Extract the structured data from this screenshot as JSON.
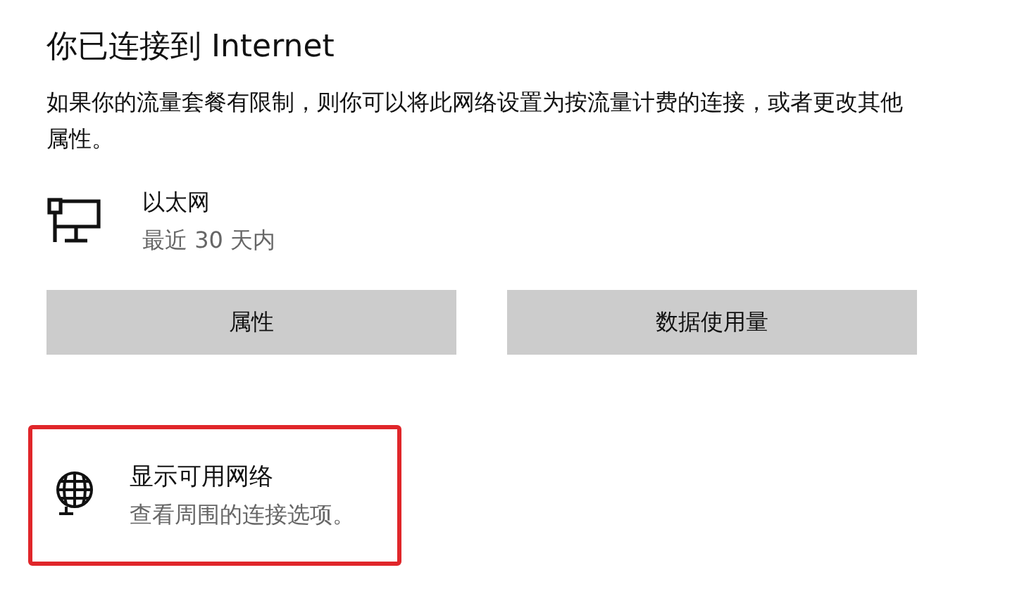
{
  "title": "你已连接到 Internet",
  "description": "如果你的流量套餐有限制，则你可以将此网络设置为按流量计费的连接，或者更改其他属性。",
  "connection": {
    "name": "以太网",
    "status": "最近 30 天内"
  },
  "buttons": [
    "属性",
    "数据使用量"
  ],
  "network_link": {
    "title": "显示可用网络",
    "subtitle": "查看周围的连接选项。",
    "highlighted": true
  }
}
